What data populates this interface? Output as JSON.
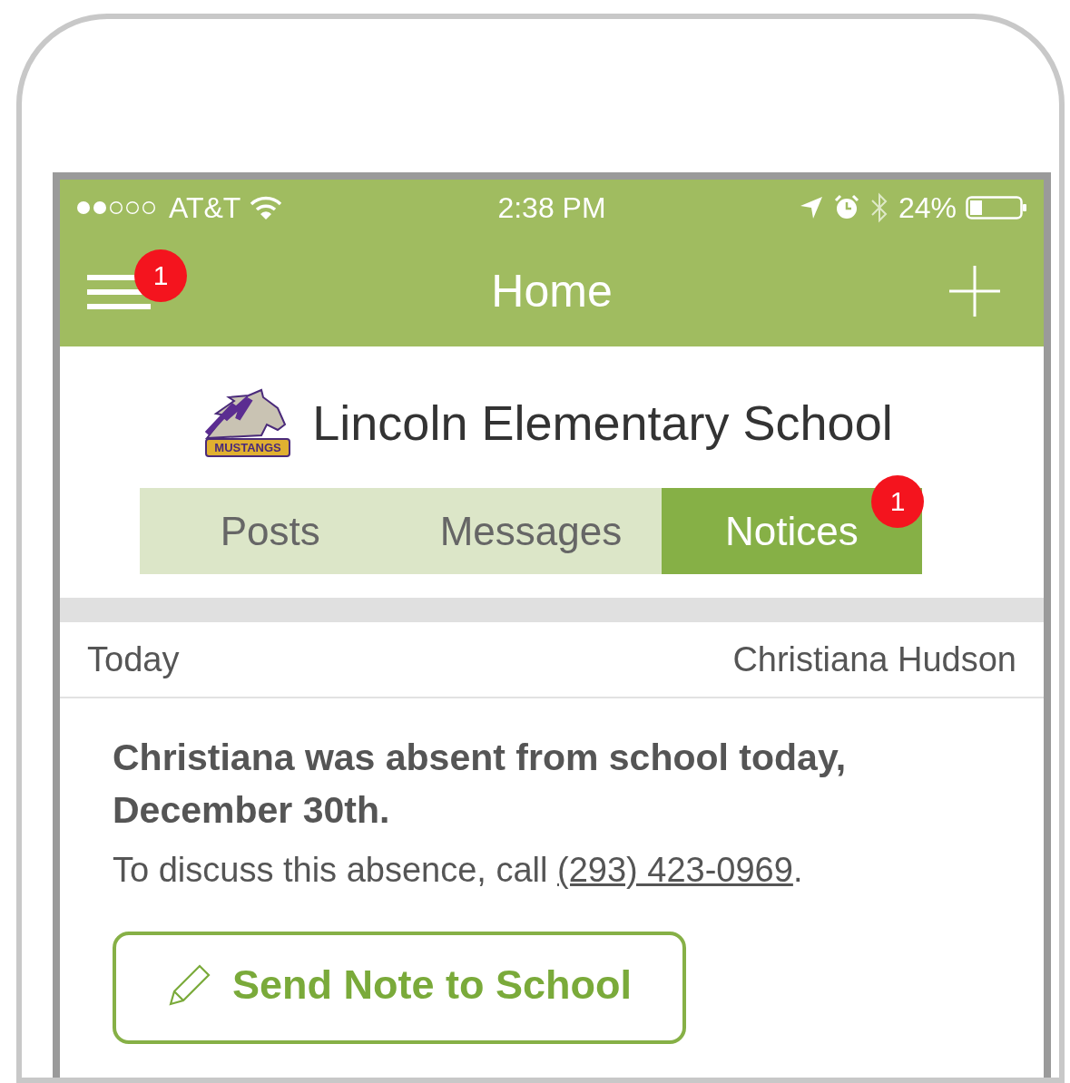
{
  "status_bar": {
    "carrier": "AT&T",
    "time": "2:38 PM",
    "battery": "24%"
  },
  "nav": {
    "title": "Home",
    "menu_badge": "1"
  },
  "school": {
    "name": "Lincoln Elementary School",
    "logo_text": "MUSTANGS"
  },
  "tabs": [
    {
      "label": "Posts",
      "selected": false
    },
    {
      "label": "Messages",
      "selected": false
    },
    {
      "label": "Notices",
      "selected": true,
      "badge": "1"
    }
  ],
  "notice": {
    "date": "Today",
    "author": "Christiana Hudson",
    "title": "Christiana was absent from school today, December 30th.",
    "text_before": "To discuss this absence, call ",
    "phone": "(293) 423-0969",
    "text_after": ".",
    "button": "Send Note to School"
  }
}
